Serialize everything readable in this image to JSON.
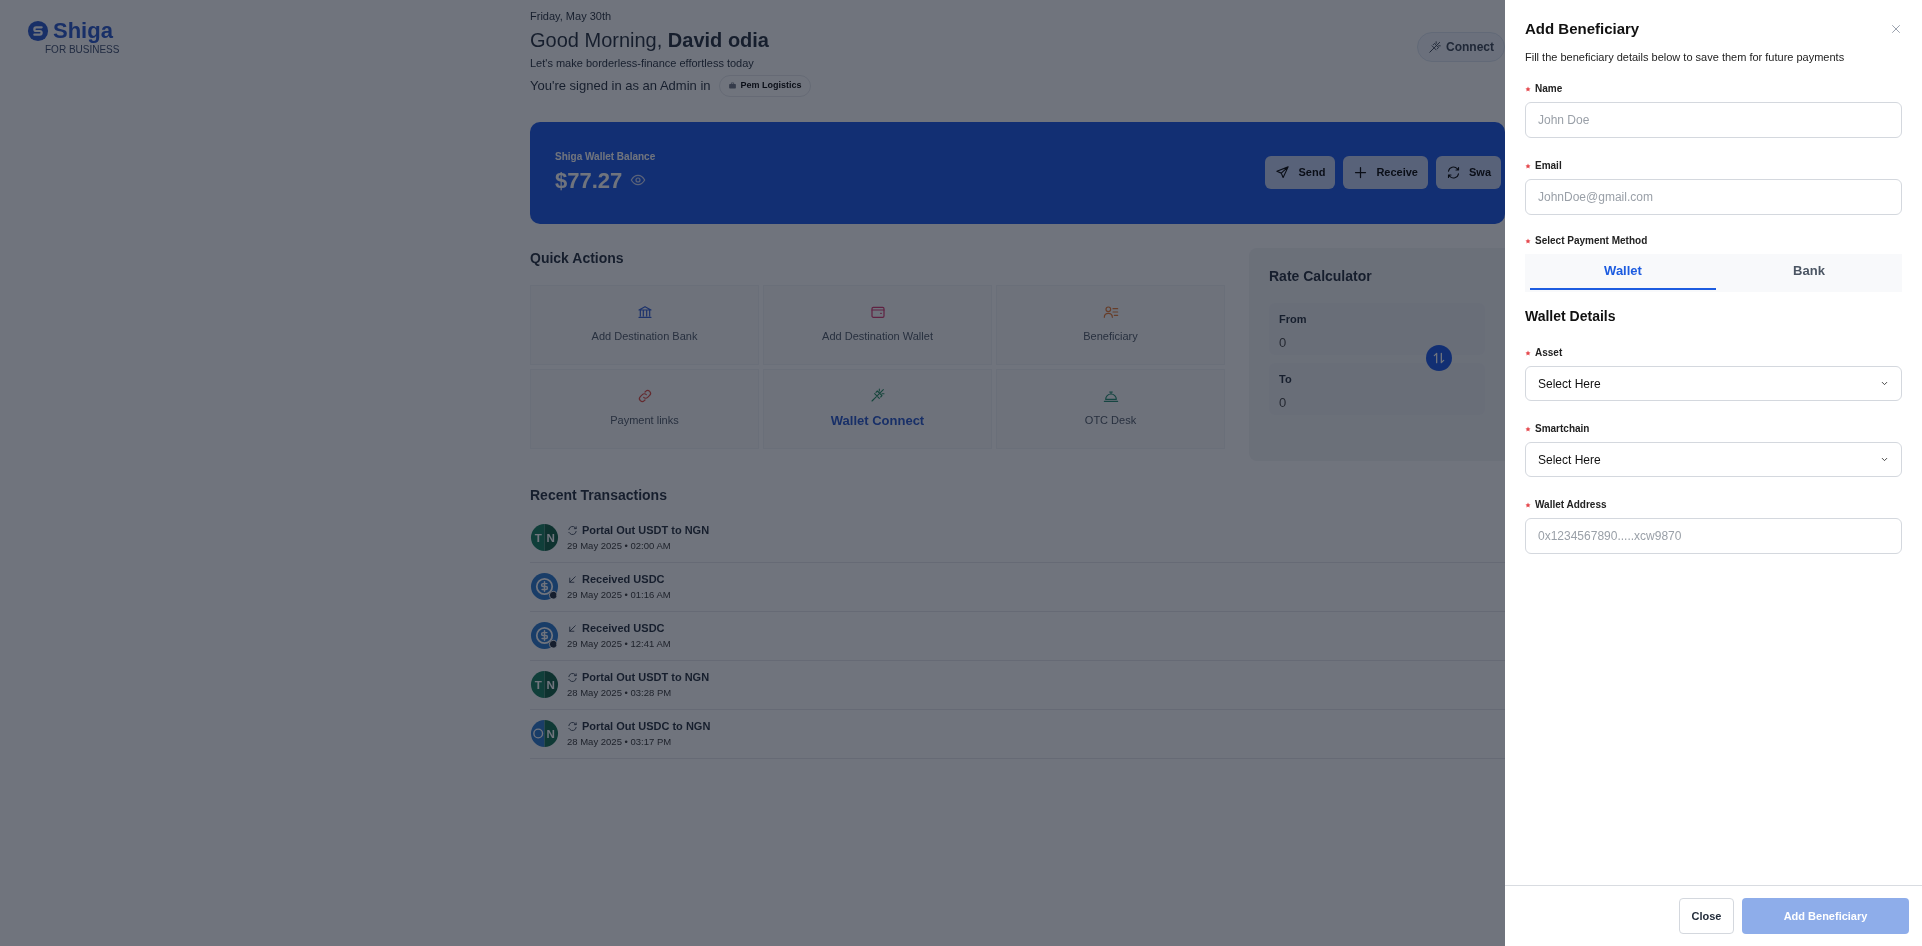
{
  "brand": {
    "name": "Shiga",
    "tagline": "FOR BUSINESS"
  },
  "header": {
    "date": "Friday, May 30th",
    "greeting": "Good Morning, **David odia**",
    "subtitle": "Let's make borderless-finance effortless today",
    "signed_in": "You're signed in as an Admin in",
    "organization": "Pem Logistics",
    "connect_button": "Connect"
  },
  "balance": {
    "label": "Shiga Wallet Balance",
    "amount": "$77.27",
    "actions": [
      {
        "kind": "send",
        "label": "Send"
      },
      {
        "kind": "receive",
        "label": "Receive"
      },
      {
        "kind": "swap",
        "label": "Swa"
      }
    ]
  },
  "quick_actions": {
    "title": "Quick Actions",
    "items": [
      {
        "kind": "bank",
        "label": "Add Destination Bank",
        "highlighted": false
      },
      {
        "kind": "wallet",
        "label": "Add Destination Wallet",
        "highlighted": false
      },
      {
        "kind": "people",
        "label": "Beneficiary",
        "highlighted": false
      },
      {
        "kind": "link",
        "label": "Payment links",
        "highlighted": false
      },
      {
        "kind": "plug",
        "label": "Wallet Connect",
        "highlighted": true
      },
      {
        "kind": "bell",
        "label": "OTC Desk",
        "highlighted": false
      }
    ]
  },
  "rate_calculator": {
    "title": "Rate Calculator",
    "from_label": "From",
    "from_value": "0",
    "to_label": "To",
    "to_value": "0"
  },
  "transactions": {
    "title": "Recent Transactions",
    "rows": [
      {
        "kind": "swap",
        "avatar": {
          "kind": "pair",
          "left": "T",
          "right": "N"
        },
        "title": "Portal Out USDT to NGN",
        "when": "29 May 2025 • 02:00 AM"
      },
      {
        "kind": "receive",
        "avatar": {
          "kind": "coin"
        },
        "title": "Received USDC",
        "when": "29 May 2025 • 01:16 AM"
      },
      {
        "kind": "receive",
        "avatar": {
          "kind": "coin"
        },
        "title": "Received USDC",
        "when": "29 May 2025 • 12:41 AM"
      },
      {
        "kind": "swap",
        "avatar": {
          "kind": "pair",
          "left": "T",
          "right": "N"
        },
        "title": "Portal Out USDT to NGN",
        "when": "28 May 2025 • 03:28 PM"
      },
      {
        "kind": "swap",
        "avatar": {
          "kind": "coin-pair",
          "right": "N"
        },
        "title": "Portal Out USDC to NGN",
        "when": "28 May 2025 • 03:17 PM"
      }
    ]
  },
  "drawer": {
    "title": "Add Beneficiary",
    "subtitle": "Fill the beneficiary details below to save them for future payments",
    "contact_fields": [
      {
        "kind": "text",
        "label": "Name",
        "required": true,
        "placeholder": "John Doe"
      },
      {
        "kind": "text",
        "label": "Email",
        "required": true,
        "placeholder": "JohnDoe@gmail.com"
      }
    ],
    "payment_method": {
      "label": "Select Payment Method",
      "required": true,
      "tabs": [
        {
          "label": "Wallet",
          "selected": true
        },
        {
          "label": "Bank",
          "selected": false
        }
      ]
    },
    "section_title": "Wallet Details",
    "fields": [
      {
        "kind": "select",
        "label": "Asset",
        "required": true,
        "value": "Select Here"
      },
      {
        "kind": "select",
        "label": "Smartchain",
        "required": true,
        "value": "Select Here"
      },
      {
        "kind": "text",
        "label": "Wallet Address",
        "required": true,
        "placeholder": "0x1234567890.....xcw9870"
      }
    ],
    "buttons": [
      {
        "kind": "secondary",
        "label": "Close",
        "disabled": false
      },
      {
        "kind": "primary",
        "label": "Add Beneficiary",
        "disabled": true
      }
    ]
  }
}
